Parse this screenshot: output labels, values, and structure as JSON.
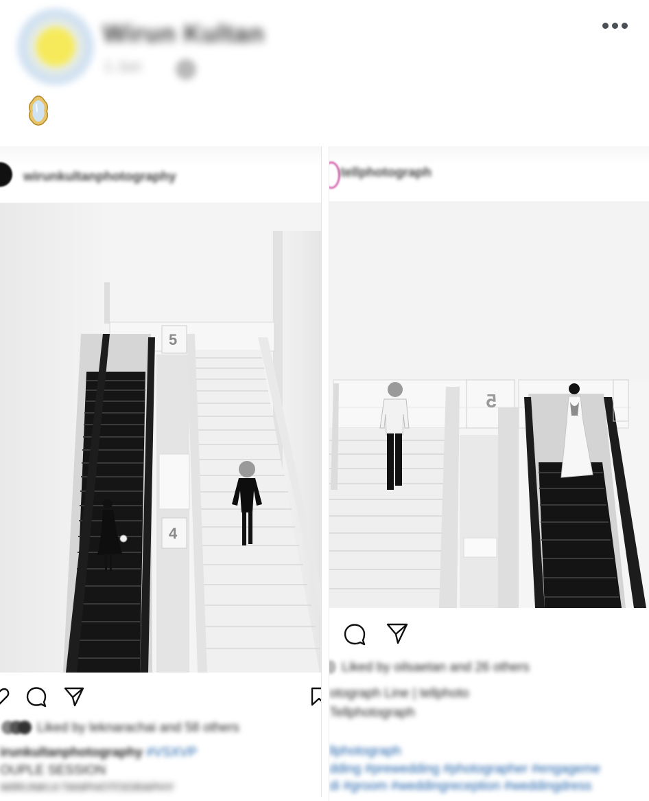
{
  "post": {
    "author_name": "Wirun Kultan",
    "meta": "1 Jun",
    "more_label": "•••"
  },
  "left_post": {
    "username": "wirunkultanphotography",
    "floor_labels": [
      "5",
      "4"
    ],
    "likes_text": "Liked by leknarachai and 58 others",
    "caption_line1_user": "irunkultanphotography",
    "caption_line1_tag": "#VSXVP",
    "caption_line2": "OUPLE SESSION",
    "caption_line3": "WIRUNKULTANPHOTOGRAPHY"
  },
  "right_post": {
    "username": "tellphotograph",
    "floor_label": "5",
    "likes_text": "Liked by oilsaetan and 26 others",
    "caption_line1": "otograph Line | tellphoto",
    "caption_line2": "Tellphotograph",
    "hashtag_line1": "llphotograph",
    "hashtag_line2": "dding #prewedding #photographer #engageme",
    "hashtag_line3": "di #groom #weddingreception #weddingdress"
  },
  "colors": {
    "hashtag_blue": "#1c5fa8",
    "text_dark": "#262626",
    "avatar_yellow": "#f6ea5a"
  },
  "icons": [
    "more-icon",
    "mirror-icon",
    "heart-icon",
    "comment-icon",
    "share-icon",
    "bookmark-icon"
  ]
}
